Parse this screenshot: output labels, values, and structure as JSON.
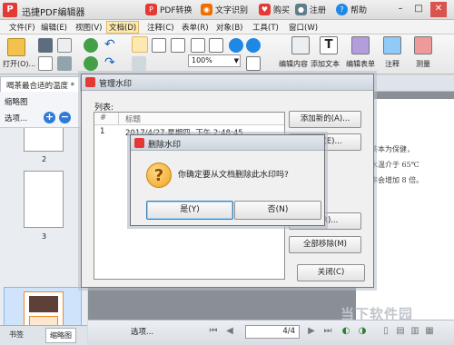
{
  "app": {
    "title": "迅捷PDF编辑器",
    "pdf_convert": "PDF转换",
    "ocr": "文字识别",
    "buy": "购买",
    "register": "注册",
    "help": "帮助",
    "minimize": "–",
    "maximize": "□",
    "close": "✕"
  },
  "menu": [
    "文件(F)",
    "编辑(E)",
    "视图(V)",
    "文档(D)",
    "注释(C)",
    "表单(R)",
    "对象(B)",
    "工具(T)",
    "窗口(W)"
  ],
  "toolbar": {
    "open": "打开(O)...",
    "zoom": "100%",
    "edit_content": "编辑内容",
    "add_text": "添加文本",
    "edit_form": "编辑表单",
    "annotate": "注释",
    "measure": "测量"
  },
  "doc_tab": "喝茶最合适的温度 *",
  "left_panel": {
    "title": "缩略图",
    "options": "选项...",
    "pages": [
      "2",
      "3",
      "4"
    ],
    "tabs": [
      "书签",
      "缩略图"
    ]
  },
  "page_text": [
    "喝茶本为保健，",
    "，水温介于 65℃",
    "生率会增加 8 倍。"
  ],
  "statusbar": {
    "options": "选项...",
    "page": "4/4"
  },
  "manage_dialog": {
    "title": "管理水印",
    "list_label": "列表:",
    "col_num": "#",
    "col_title": "标题",
    "rows": [
      {
        "num": "1",
        "title": "2017/4/27 星期四, 下午 2:48:45"
      }
    ],
    "add_button": "添加新的(A)...",
    "edit_button": "编辑(E)...",
    "hidden_button": "...(R)...",
    "remove_all_button": "全部移除(M)",
    "close_button": "关闭(C)"
  },
  "confirm_dialog": {
    "title": "删除水印",
    "message": "你确定要从文档删除此水印吗?",
    "yes": "是(Y)",
    "no": "否(N)"
  },
  "watermark_text": "当下软件园"
}
